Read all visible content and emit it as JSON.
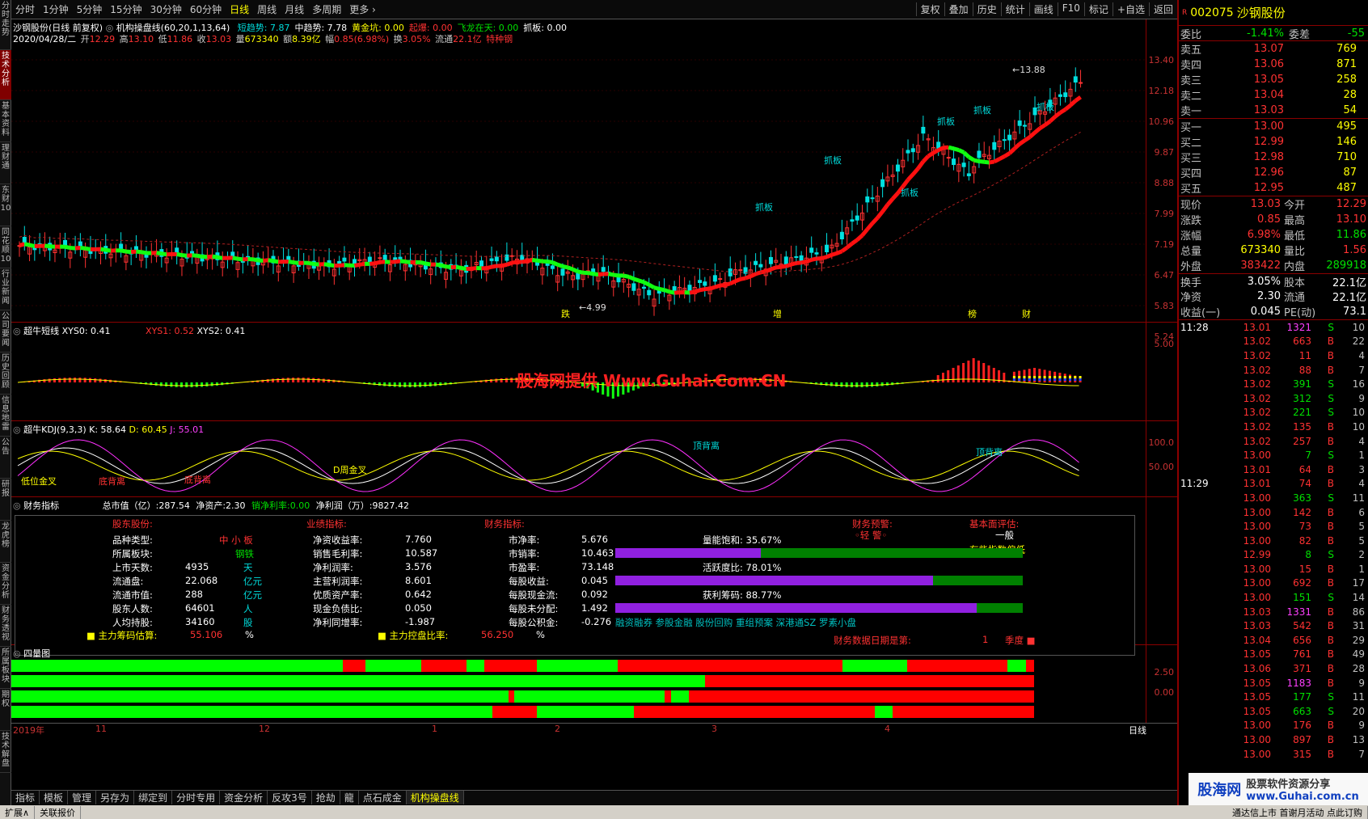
{
  "left_sidebar": [
    "分时走势",
    "技术分析",
    "基本资料",
    "理财通",
    "东财10",
    "同花顺10",
    "行业新闻",
    "公司要闻",
    "历史回顾",
    "信息地雷",
    "公告",
    "研报",
    "龙虎榜",
    "资金分析",
    "财务透视",
    "所属板块",
    "期权",
    "技术解盘"
  ],
  "topbar": {
    "periods": [
      "分时",
      "1分钟",
      "5分钟",
      "15分钟",
      "30分钟",
      "60分钟",
      "日线",
      "周线",
      "月线",
      "多周期",
      "更多 ›"
    ],
    "tools": [
      "复权",
      "叠加",
      "历史",
      "统计",
      "画线",
      "F10",
      "标记",
      "+自选",
      "返回"
    ]
  },
  "main_chart": {
    "title_line": "沙钢股份(日线 前复权)",
    "indicator": "机构操盘线(60,20,1,13,64)",
    "values": [
      {
        "label": "短趋势:",
        "value": "7.87",
        "color": "#00dcdc"
      },
      {
        "label": "中趋势:",
        "value": "7.78",
        "color": "#ffffff"
      },
      {
        "label": "黄金坑:",
        "value": "0.00",
        "color": "#ffff00"
      },
      {
        "label": "起爆:",
        "value": "0.00",
        "color": "#ff3232"
      },
      {
        "label": "飞龙在天:",
        "value": "0.00",
        "color": "#00e000"
      },
      {
        "label": "抓板:",
        "value": "0.00",
        "color": "#ffffff"
      }
    ],
    "date": "2020/04/28/二",
    "ohlc": [
      {
        "k": "开",
        "v": "12.29"
      },
      {
        "k": "高",
        "v": "13.10"
      },
      {
        "k": "低",
        "v": "11.86"
      },
      {
        "k": "收",
        "v": "13.03"
      },
      {
        "k": "量",
        "v": "673340"
      },
      {
        "k": "额",
        "v": "8.39亿"
      },
      {
        "k": "幅",
        "v": "0.85(6.98%)"
      },
      {
        "k": "换",
        "v": "3.05%"
      },
      {
        "k": "流通",
        "v": "22.1亿"
      },
      {
        "k": "",
        "v": "特种钢"
      }
    ],
    "y_ticks": [
      "13.40",
      "12.18",
      "10.96",
      "9.87",
      "8.88",
      "7.99",
      "7.19",
      "6.47",
      "5.83",
      "5.24"
    ],
    "annotations": {
      "high": "13.88",
      "low": "4.99",
      "signals": [
        "抓板",
        "抓板",
        "抓板",
        "抓板",
        "抓板",
        "抓板"
      ],
      "events": [
        "跌",
        "增",
        "榜",
        "财"
      ]
    }
  },
  "short_line": {
    "title": "超牛短线",
    "xys0": "XYS0: 0.41",
    "xys1": "XYS1: 0.52",
    "xys2": "XYS2: 0.41",
    "y_tick": "5.00",
    "watermark": "股海网提供 Www.Guhai.Com.CN"
  },
  "kdj": {
    "title": "超牛KDJ(9,3,3)",
    "k": "K: 58.64",
    "d": "D: 60.45",
    "j": "J: 55.01",
    "y_ticks": [
      "100.0",
      "50.00"
    ],
    "labels": [
      "低位金叉",
      "底背离",
      "底背离",
      "D周金叉",
      "顶背离",
      "顶背离"
    ]
  },
  "finance": {
    "title": "财务指标",
    "summary": [
      {
        "k": "总市值（亿）:",
        "v": "287.54"
      },
      {
        "k": "净资产:",
        "v": "2.30"
      },
      {
        "k": "销净利率:",
        "v": "0.00"
      },
      {
        "k": "净利润（万）:",
        "v": "9827.42"
      }
    ],
    "sections": [
      "股东股份:",
      "业绩指标:",
      "财务指标:",
      "财务预警:",
      "基本面评估:"
    ],
    "col1": [
      {
        "k": "品种类型:",
        "v": "中 小 板",
        "u": ""
      },
      {
        "k": "所属板块:",
        "v": "钢铁",
        "u": ""
      },
      {
        "k": "上市天数:",
        "v": "4935",
        "u": "天"
      },
      {
        "k": "流通盘:",
        "v": "22.068",
        "u": "亿元"
      },
      {
        "k": "流通市值:",
        "v": "288",
        "u": "亿元"
      },
      {
        "k": "股东人数:",
        "v": "64601",
        "u": "人"
      },
      {
        "k": "人均持股:",
        "v": "34160",
        "u": "股"
      }
    ],
    "col2": [
      {
        "k": "净资收益率:",
        "v": "7.760"
      },
      {
        "k": "销售毛利率:",
        "v": "10.587"
      },
      {
        "k": "净利润率:",
        "v": "3.576"
      },
      {
        "k": "主营利润率:",
        "v": "8.601"
      },
      {
        "k": "优质资产率:",
        "v": "0.642"
      },
      {
        "k": "现金负债比:",
        "v": "0.050"
      },
      {
        "k": "净利同增率:",
        "v": "-1.987"
      }
    ],
    "col3": [
      {
        "k": "市净率:",
        "v": "5.676"
      },
      {
        "k": "市销率:",
        "v": "10.463"
      },
      {
        "k": "市盈率:",
        "v": "73.148"
      },
      {
        "k": "每股收益:",
        "v": "0.045"
      },
      {
        "k": "每股现金流:",
        "v": "0.092"
      },
      {
        "k": "每股未分配:",
        "v": "1.492"
      },
      {
        "k": "每股公积金:",
        "v": "-0.276"
      }
    ],
    "warning": "◦轻 警◦",
    "eval": "一般",
    "eval2": "有些指数偏低",
    "bars": [
      {
        "k": "量能饱和:",
        "v": "35.67%",
        "pct": 0.3567
      },
      {
        "k": "活跃度比:",
        "v": "78.01%",
        "pct": 0.7801
      },
      {
        "k": "获利筹码:",
        "v": "88.77%",
        "pct": 0.8877
      }
    ],
    "tags": "融资融券 参股金融 股份回购 重组预案 深港通SZ 罗素小盘",
    "bottom": [
      {
        "k": "主力筹码估算:",
        "v": "55.106",
        "u": "%"
      },
      {
        "k": "主力控盘比率:",
        "v": "56.250",
        "u": "%"
      }
    ],
    "date_label": "财务数据日期是第:",
    "date_v": "1",
    "date_u": "季度"
  },
  "quadrant": {
    "title": "四量图",
    "y_ticks": [
      "2.50",
      "0.00"
    ]
  },
  "x_axis": {
    "labels": [
      "2019年",
      "11",
      "12",
      "1",
      "2",
      "3",
      "4"
    ],
    "period": "日线"
  },
  "bottom_tabs": [
    "指标",
    "模板",
    "管理",
    "另存为",
    "绑定到",
    "分时专用",
    "资金分析",
    "反攻3号",
    "抢劫",
    "龍",
    "点石成金",
    "机构操盘线"
  ],
  "right_panel": {
    "code": "002075",
    "name": "沙钢股份",
    "weibi": {
      "k": "委比",
      "v": "-1.41%",
      "k2": "委差",
      "v2": "-55"
    },
    "sells": [
      {
        "k": "卖五",
        "p": "13.07",
        "v": "769"
      },
      {
        "k": "卖四",
        "p": "13.06",
        "v": "871"
      },
      {
        "k": "卖三",
        "p": "13.05",
        "v": "258"
      },
      {
        "k": "卖二",
        "p": "13.04",
        "v": "28"
      },
      {
        "k": "卖一",
        "p": "13.03",
        "v": "54"
      }
    ],
    "buys": [
      {
        "k": "买一",
        "p": "13.00",
        "v": "495"
      },
      {
        "k": "买二",
        "p": "12.99",
        "v": "146"
      },
      {
        "k": "买三",
        "p": "12.98",
        "v": "710"
      },
      {
        "k": "买四",
        "p": "12.96",
        "v": "87"
      },
      {
        "k": "买五",
        "p": "12.95",
        "v": "487"
      }
    ],
    "stats": [
      {
        "k": "现价",
        "v": "13.03",
        "k2": "今开",
        "v2": "12.29"
      },
      {
        "k": "涨跌",
        "v": "0.85",
        "k2": "最高",
        "v2": "13.10"
      },
      {
        "k": "涨幅",
        "v": "6.98%",
        "k2": "最低",
        "v2": "11.86"
      },
      {
        "k": "总量",
        "v": "673340",
        "k2": "量比",
        "v2": "1.56"
      },
      {
        "k": "外盘",
        "v": "383422",
        "k2": "内盘",
        "v2": "289918"
      },
      {
        "k": "换手",
        "v": "3.05%",
        "k2": "股本",
        "v2": "22.1亿"
      },
      {
        "k": "净资",
        "v": "2.30",
        "k2": "流通",
        "v2": "22.1亿"
      },
      {
        "k": "收益(一)",
        "v": "0.045",
        "k2": "PE(动)",
        "v2": "73.1"
      }
    ],
    "ticks": [
      {
        "t": "11:28",
        "p": "13.01",
        "v": "1321",
        "s": "S",
        "n": "10"
      },
      {
        "t": "",
        "p": "13.02",
        "v": "663",
        "s": "B",
        "n": "22"
      },
      {
        "t": "",
        "p": "13.02",
        "v": "11",
        "s": "B",
        "n": "4"
      },
      {
        "t": "",
        "p": "13.02",
        "v": "88",
        "s": "B",
        "n": "7"
      },
      {
        "t": "",
        "p": "13.02",
        "v": "391",
        "s": "S",
        "n": "16"
      },
      {
        "t": "",
        "p": "13.02",
        "v": "312",
        "s": "S",
        "n": "9"
      },
      {
        "t": "",
        "p": "13.02",
        "v": "221",
        "s": "S",
        "n": "10"
      },
      {
        "t": "",
        "p": "13.02",
        "v": "135",
        "s": "B",
        "n": "10"
      },
      {
        "t": "",
        "p": "13.02",
        "v": "257",
        "s": "B",
        "n": "4"
      },
      {
        "t": "",
        "p": "13.00",
        "v": "7",
        "s": "S",
        "n": "1"
      },
      {
        "t": "",
        "p": "13.01",
        "v": "64",
        "s": "B",
        "n": "3"
      },
      {
        "t": "11:29",
        "p": "13.01",
        "v": "74",
        "s": "B",
        "n": "4"
      },
      {
        "t": "",
        "p": "13.00",
        "v": "363",
        "s": "S",
        "n": "11"
      },
      {
        "t": "",
        "p": "13.00",
        "v": "142",
        "s": "B",
        "n": "6"
      },
      {
        "t": "",
        "p": "13.00",
        "v": "73",
        "s": "B",
        "n": "5"
      },
      {
        "t": "",
        "p": "13.00",
        "v": "82",
        "s": "B",
        "n": "5"
      },
      {
        "t": "",
        "p": "12.99",
        "v": "8",
        "s": "S",
        "n": "2"
      },
      {
        "t": "",
        "p": "13.00",
        "v": "15",
        "s": "B",
        "n": "1"
      },
      {
        "t": "",
        "p": "13.00",
        "v": "692",
        "s": "B",
        "n": "17"
      },
      {
        "t": "",
        "p": "13.00",
        "v": "151",
        "s": "S",
        "n": "14"
      },
      {
        "t": "",
        "p": "13.03",
        "v": "1331",
        "s": "B",
        "n": "86"
      },
      {
        "t": "",
        "p": "13.03",
        "v": "542",
        "s": "B",
        "n": "31"
      },
      {
        "t": "",
        "p": "13.04",
        "v": "656",
        "s": "B",
        "n": "29"
      },
      {
        "t": "",
        "p": "13.05",
        "v": "761",
        "s": "B",
        "n": "49"
      },
      {
        "t": "",
        "p": "13.06",
        "v": "371",
        "s": "B",
        "n": "28"
      },
      {
        "t": "",
        "p": "13.05",
        "v": "1183",
        "s": "B",
        "n": "9"
      },
      {
        "t": "",
        "p": "13.05",
        "v": "177",
        "s": "S",
        "n": "11"
      },
      {
        "t": "",
        "p": "13.05",
        "v": "663",
        "s": "S",
        "n": "20"
      },
      {
        "t": "",
        "p": "13.00",
        "v": "176",
        "s": "B",
        "n": "9"
      },
      {
        "t": "",
        "p": "13.00",
        "v": "897",
        "s": "B",
        "n": "13"
      },
      {
        "t": "",
        "p": "13.00",
        "v": "315",
        "s": "B",
        "n": "7"
      }
    ]
  },
  "watermark": {
    "a": "股海网",
    "b": "股票软件资源分享",
    "c": "www.Guhai.com.cn"
  },
  "statusbar": [
    "扩展∧",
    "关联报价",
    "通达信上市 首谢月活动 点此订购"
  ]
}
